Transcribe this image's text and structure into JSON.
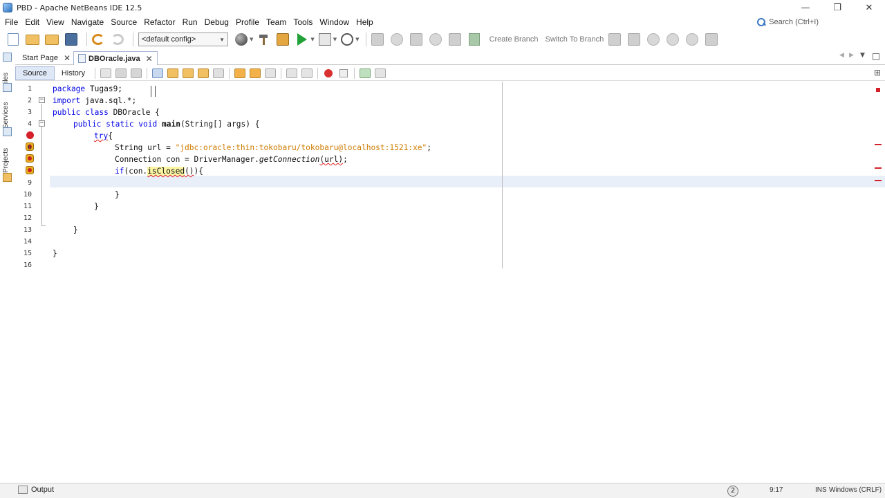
{
  "window": {
    "title": "PBD - Apache NetBeans IDE 12.5",
    "controls": {
      "minimize": "—",
      "restore": "❐",
      "close": "✕"
    }
  },
  "menu": [
    "File",
    "Edit",
    "View",
    "Navigate",
    "Source",
    "Refactor",
    "Run",
    "Debug",
    "Profile",
    "Team",
    "Tools",
    "Window",
    "Help"
  ],
  "search": {
    "placeholder": "Search (Ctrl+I)"
  },
  "toolbar": {
    "config": "<default config>",
    "create_branch": "Create Branch",
    "switch_branch": "Switch To Branch"
  },
  "tabs": [
    {
      "label": "Start Page",
      "close": "✕",
      "active": false
    },
    {
      "label": "DBOracle.java",
      "close": "✕",
      "active": true
    }
  ],
  "editor_toolbar": {
    "source": "Source",
    "history": "History"
  },
  "side_panels": [
    "Files",
    "Services",
    "Projects"
  ],
  "code_lines": [
    "1",
    "2",
    "3",
    "4",
    "5",
    "6",
    "7",
    "8",
    "9",
    "10",
    "11",
    "12",
    "13",
    "14",
    "15",
    "16"
  ],
  "code": {
    "l1_kw": "package",
    "l1_rest": " Tugas9;",
    "l2_kw": "import",
    "l2_rest": " java.sql.*;",
    "l3_kw": "public class",
    "l3_rest": " DBOracle {",
    "l4_kw": "public static void",
    "l4_name": " main",
    "l4_rest": "(String[] args) {",
    "l5_kw": "try",
    "l5_rest": "{",
    "l6_pre": "String url = ",
    "l6_str": "\"jdbc:oracle:thin:tokobaru/tokobaru@localhost:1521:xe\"",
    "l6_end": ";",
    "l7_pre": "Connection ",
    "l7_var": "con",
    "l7_mid": " = DriverManager.",
    "l7_meth": "getConnection",
    "l7_arg": "(url)",
    "l7_end": ";",
    "l8_kw": "if",
    "l8_pre": "(con.",
    "l8_meth": "isClosed",
    "l8_call": "()",
    "l8_end": "){",
    "l10": "}",
    "l11": "}",
    "l13": "}",
    "l15": "}"
  },
  "status": {
    "output": "Output",
    "notifications": "2",
    "position": "9:17",
    "mode": "INS",
    "line_endings": "Windows (CRLF)"
  }
}
